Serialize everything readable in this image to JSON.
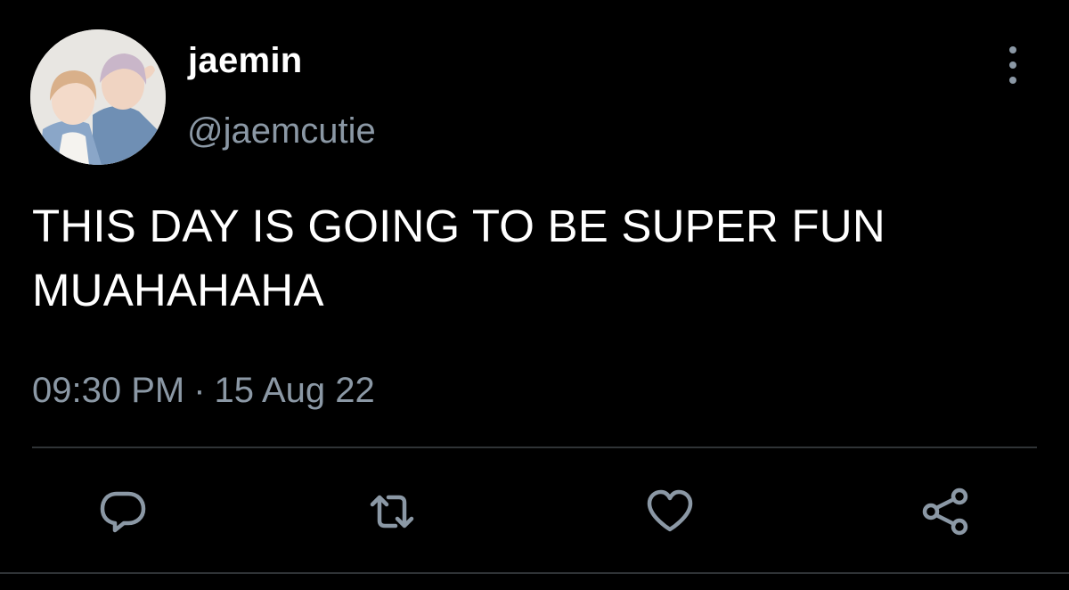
{
  "user": {
    "display_name": "jaemin",
    "handle": "@jaemcutie",
    "avatar_icon": "profile-photo"
  },
  "tweet": {
    "text": "THIS DAY IS GOING TO BE SUPER FUN MUAHAHAHA",
    "time": "09:30 PM",
    "separator": "·",
    "date": "15 Aug 22"
  },
  "actions": {
    "reply_icon": "reply-icon",
    "retweet_icon": "retweet-icon",
    "like_icon": "heart-icon",
    "share_icon": "share-icon",
    "more_icon": "more-vertical-icon"
  },
  "colors": {
    "background": "#000000",
    "primary_text": "#ffffff",
    "secondary_text": "#8b98a5",
    "divider": "#2f3336"
  }
}
